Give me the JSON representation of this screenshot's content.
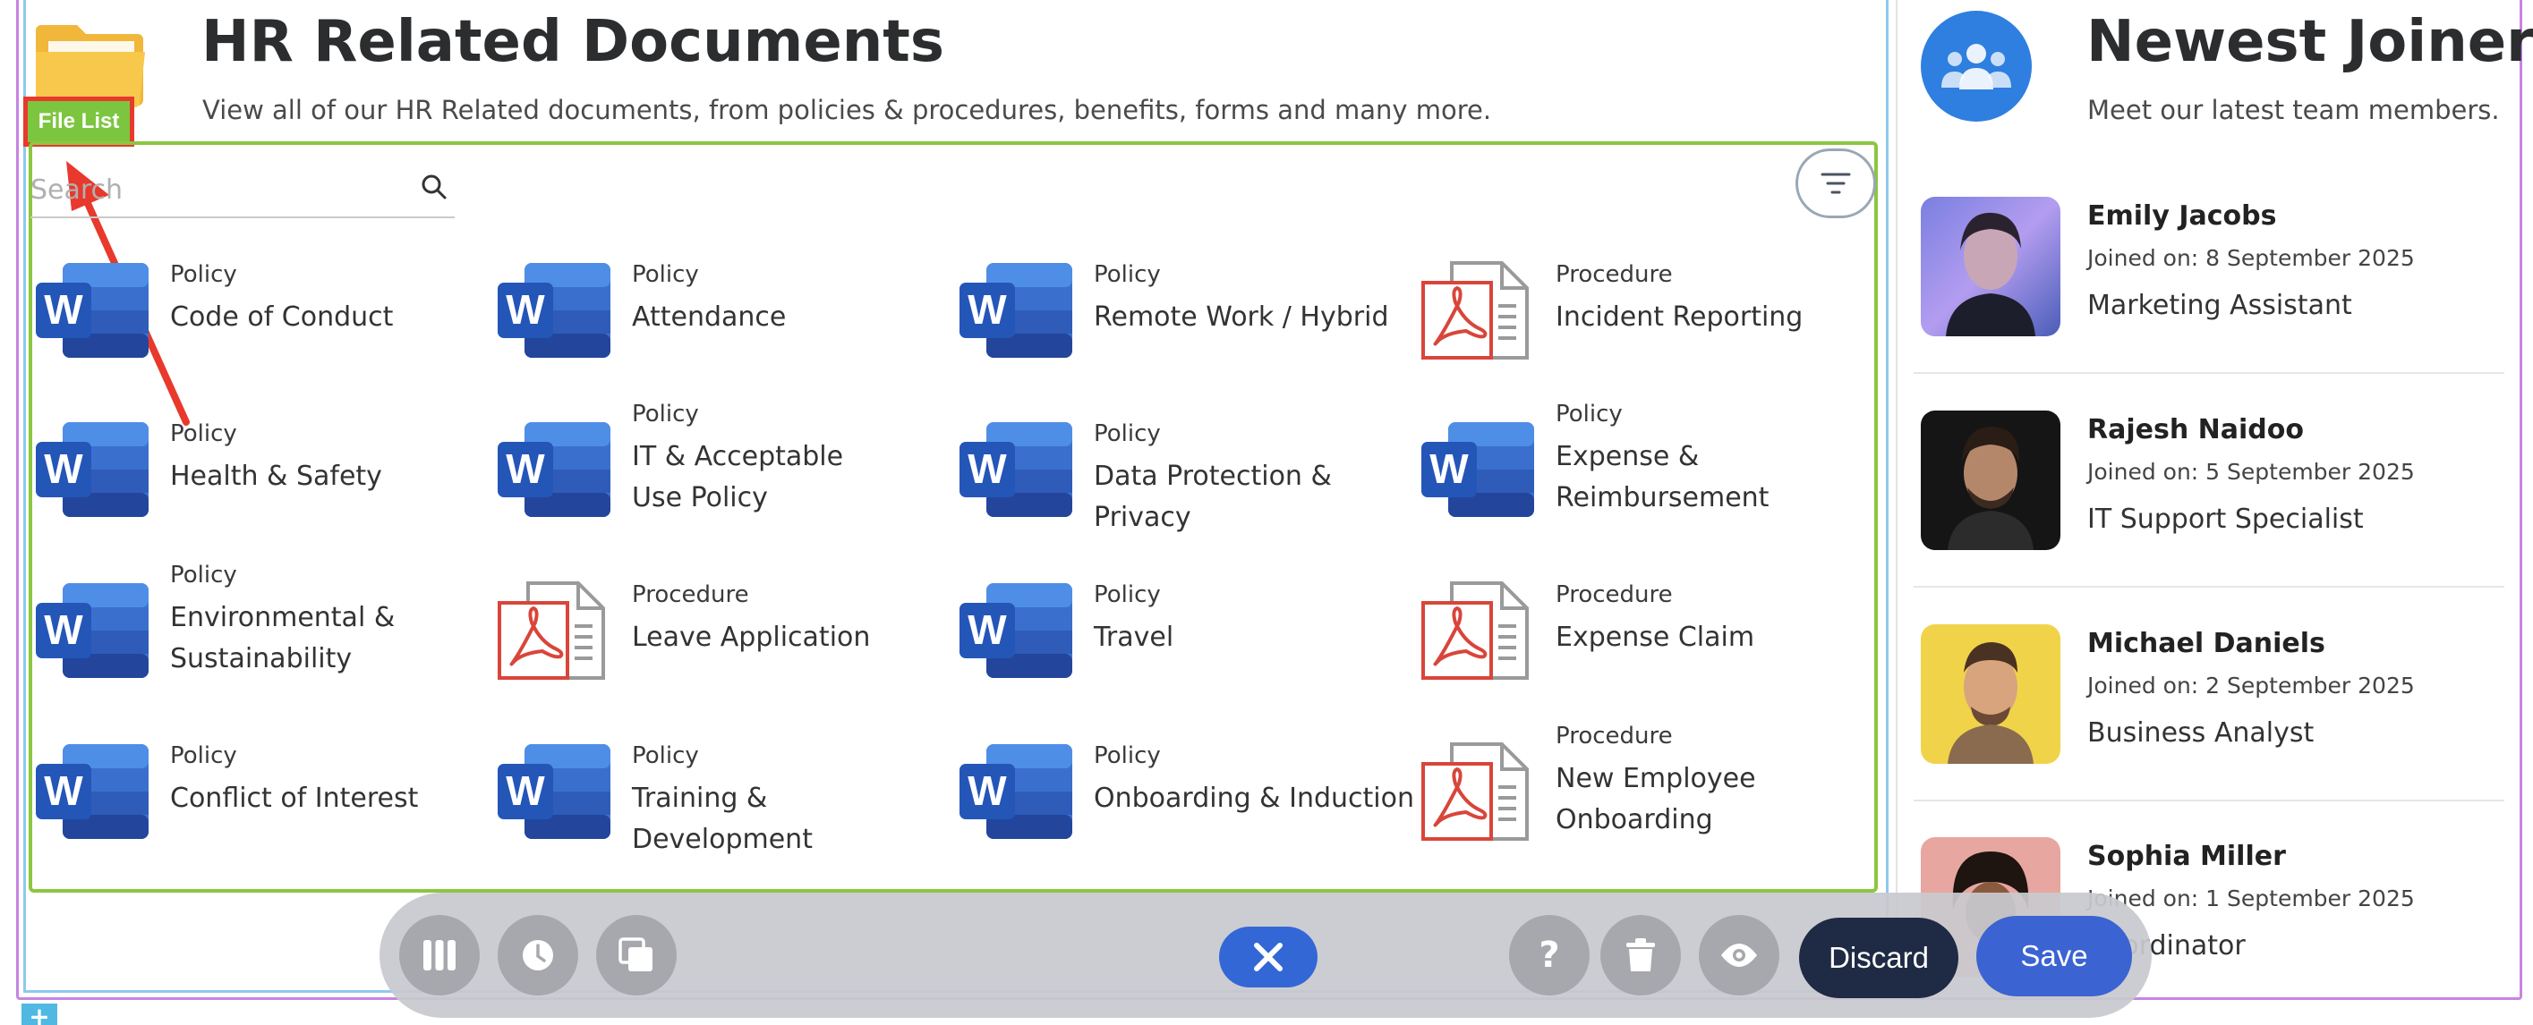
{
  "header": {
    "title": "HR Related Documents",
    "subtitle": "View all of our HR Related documents, from policies & procedures, benefits, forms and many more.",
    "badge": "File List",
    "folder_icon": "folder-icon"
  },
  "search": {
    "placeholder": "Search",
    "value": ""
  },
  "documents": [
    {
      "type": "Policy",
      "name": "Code of Conduct",
      "icon": "word-doc-icon"
    },
    {
      "type": "Policy",
      "name": "Attendance",
      "icon": "word-doc-icon"
    },
    {
      "type": "Policy",
      "name": "Remote Work / Hybrid",
      "icon": "word-doc-icon"
    },
    {
      "type": "Procedure",
      "name": "Incident Reporting",
      "icon": "pdf-doc-icon"
    },
    {
      "type": "Policy",
      "name": "Health & Safety",
      "icon": "word-doc-icon"
    },
    {
      "type": "Policy",
      "name": "IT & Acceptable Use Policy",
      "icon": "word-doc-icon"
    },
    {
      "type": "Policy",
      "name": "Data Protection & Privacy",
      "icon": "word-doc-icon"
    },
    {
      "type": "Policy",
      "name": "Expense & Reimbursement",
      "icon": "word-doc-icon"
    },
    {
      "type": "Policy",
      "name": "Environmental & Sustainability",
      "icon": "word-doc-icon"
    },
    {
      "type": "Procedure",
      "name": "Leave Application",
      "icon": "pdf-doc-icon"
    },
    {
      "type": "Policy",
      "name": "Travel",
      "icon": "word-doc-icon"
    },
    {
      "type": "Procedure",
      "name": "Expense Claim",
      "icon": "pdf-doc-icon"
    },
    {
      "type": "Policy",
      "name": "Conflict of Interest",
      "icon": "word-doc-icon"
    },
    {
      "type": "Policy",
      "name": "Training & Development",
      "icon": "word-doc-icon"
    },
    {
      "type": "Policy",
      "name": "Onboarding & Induction",
      "icon": "word-doc-icon"
    },
    {
      "type": "Procedure",
      "name": "New Employee Onboarding",
      "icon": "pdf-doc-icon"
    }
  ],
  "joiners": {
    "title": "Newest Joiners",
    "subtitle": "Meet our latest team members.",
    "items": [
      {
        "name": "Emily Jacobs",
        "joined": "Joined on: 8 September 2025",
        "role": "Marketing Assistant"
      },
      {
        "name": "Rajesh Naidoo",
        "joined": "Joined on: 5 September 2025",
        "role": "IT Support Specialist"
      },
      {
        "name": "Michael Daniels",
        "joined": "Joined on: 2 September 2025",
        "role": "Business Analyst"
      },
      {
        "name": "Sophia Miller",
        "joined": "Joined on: 1 September 2025",
        "role": "Coordinator"
      }
    ]
  },
  "toolbar": {
    "discard_label": "Discard",
    "save_label": "Save",
    "icons": [
      "columns-icon",
      "clock-icon",
      "layers-icon",
      "close-icon",
      "help-icon",
      "trash-icon",
      "eye-icon"
    ]
  },
  "colors": {
    "word_blue": "#2b5cc4",
    "pdf_red": "#d9453a",
    "badge_green": "#7cc63f",
    "highlight_red": "#e8392c",
    "save_blue": "#3b63d1",
    "discard_navy": "#1f2a44"
  }
}
